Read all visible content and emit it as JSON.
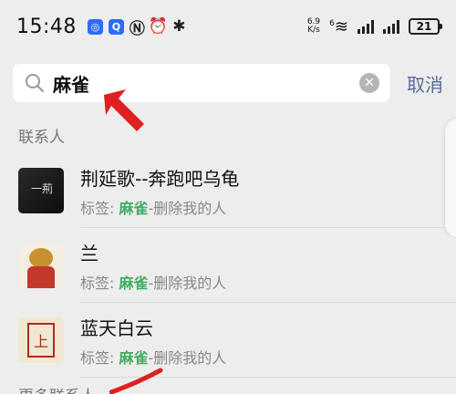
{
  "status_bar": {
    "time": "15:48",
    "net_speed_value": "6.9",
    "net_speed_unit": "K/s",
    "wifi_label": "6",
    "battery": "21"
  },
  "search": {
    "query": "麻雀",
    "cancel_label": "取消"
  },
  "contacts_section": {
    "header": "联系人",
    "items": [
      {
        "name": "荆延歌--奔跑吧乌龟",
        "tag_prefix": "标签: ",
        "tag_highlight": "麻雀",
        "tag_suffix": "-删除我的人"
      },
      {
        "name": "兰",
        "tag_prefix": "标签: ",
        "tag_highlight": "麻雀",
        "tag_suffix": "-删除我的人"
      },
      {
        "name": "蓝天白云",
        "tag_prefix": "标签: ",
        "tag_highlight": "麻雀",
        "tag_suffix": "-删除我的人"
      }
    ]
  },
  "next_section_header": "更多联系人",
  "colors": {
    "highlight": "#3fae61",
    "cancel": "#576b95",
    "annotation_arrow": "#e02020"
  }
}
